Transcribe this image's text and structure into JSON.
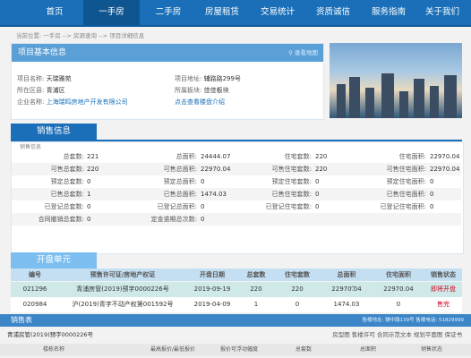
{
  "nav": {
    "items": [
      "首页",
      "一手房",
      "二手房",
      "房屋租赁",
      "交易统计",
      "资质诚信",
      "服务指南",
      "关于我们"
    ],
    "active_index": 1
  },
  "breadcrumb": "当前位置: 一手房 --> 房源查询 --> 项目详细信息",
  "basic": {
    "title": "项目基本信息",
    "map_link": "查看地图",
    "name_label": "项目名称:",
    "name": "天瑞雅苑",
    "district_label": "所在区县:",
    "district": "青浦区",
    "company_label": "企业名称:",
    "company": "上海瑞鸣房地产开发有限公司",
    "address_label": "项目地址:",
    "address": "辅路路299号",
    "block_label": "所属板块:",
    "block": "佳佳板块",
    "more_link": "点击查看楼盘介绍"
  },
  "sales": {
    "tab": "销售信息",
    "subtitle": "销售信息",
    "rows": [
      [
        [
          "总套数:",
          "221"
        ],
        [
          "总面积:",
          "24444.07"
        ],
        [
          "住宅套数:",
          "220"
        ],
        [
          "住宅面积:",
          "22970.04"
        ]
      ],
      [
        [
          "可售总套数:",
          "220"
        ],
        [
          "可售总面积:",
          "22970.04"
        ],
        [
          "可售住宅套数:",
          "220"
        ],
        [
          "可售住宅面积:",
          "22970.04"
        ]
      ],
      [
        [
          "预定总套数:",
          "0"
        ],
        [
          "预定总面积:",
          "0"
        ],
        [
          "预定住宅套数:",
          "0"
        ],
        [
          "预定住宅面积:",
          "0"
        ]
      ],
      [
        [
          "已售总套数:",
          "1"
        ],
        [
          "已售总面积:",
          "1474.03"
        ],
        [
          "已售住宅套数:",
          "0"
        ],
        [
          "已售住宅面积:",
          "0"
        ]
      ],
      [
        [
          "已登记总套数:",
          "0"
        ],
        [
          "已登记总面积:",
          "0"
        ],
        [
          "已登记住宅套数:",
          "0"
        ],
        [
          "已登记住宅面积:",
          "0"
        ]
      ],
      [
        [
          "合同撤销总套数:",
          "0"
        ],
        [
          "定金逾期总次数:",
          "0"
        ]
      ]
    ]
  },
  "presale": {
    "tab": "开盘单元",
    "headers": [
      "编号",
      "预售许可证/房地产权证",
      "开盘日期",
      "总套数",
      "住宅套数",
      "总面积",
      "住宅面积",
      "销售状态"
    ],
    "rows": [
      [
        "021296",
        "青浦房管(2019)预字0000226号",
        "2019-09-19",
        "220",
        "220",
        "22970.04",
        "22970.04",
        "即将开盘"
      ],
      [
        "020984",
        "沪(2019)青字不动产权第001592号",
        "2019-04-09",
        "1",
        "0",
        "1474.03",
        "0",
        "售完"
      ]
    ]
  },
  "sales_table": {
    "title": "销售表",
    "note": "售楼地址: 辅中路139号 售楼电话: 51829999",
    "permit": "青浦房管(2019)预字0000226号",
    "links": "房型图  售楼许可  合同示范文本  规划平面图  保证书",
    "headers": [
      "楼栋名称",
      "最高报价/最低报价",
      "报价可浮动幅度",
      "总套数",
      "总面积",
      "销售状态"
    ]
  },
  "colors": {
    "nav_bg": "#1a6fb8",
    "section_tab": "#1a6fb8",
    "presale_tab": "#7cbef0",
    "status_red": "#d0021b"
  }
}
